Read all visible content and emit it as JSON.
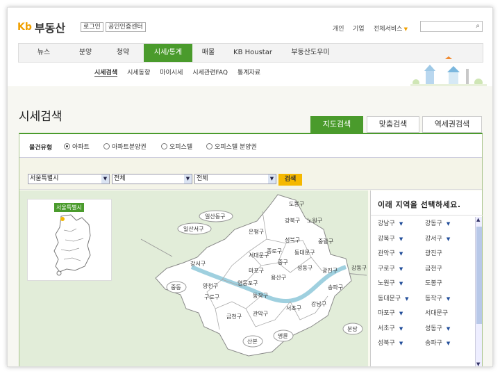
{
  "header": {
    "logo_mark": "Kb",
    "logo_text": "부동산",
    "login": "로그인",
    "agent_center": "공인인증센터",
    "links": [
      "개인",
      "기업",
      "전체서비스"
    ],
    "search_placeholder": ""
  },
  "gnb": [
    "뉴스",
    "분양",
    "청약",
    "시세/통계",
    "매물",
    "KB Houstar",
    "부동산도우미"
  ],
  "subnav": [
    "시세검색",
    "시세동향",
    "마이시세",
    "시세관련FAQ",
    "통계자료"
  ],
  "page_title": "시세검색",
  "tabs": [
    "지도검색",
    "맞춤검색",
    "역세권검색"
  ],
  "filter": {
    "label": "물건유형",
    "options": [
      "아파트",
      "아파트분양권",
      "오피스텔",
      "오피스텔 분양권"
    ],
    "selected": "아파트"
  },
  "selects": {
    "city": "서울특별시",
    "district": "전체",
    "dong": "전체",
    "search_button": "검색"
  },
  "minimap_tag": "서울특별시",
  "map_labels": [
    "도봉구",
    "노원구",
    "강북구",
    "은평구",
    "성북구",
    "중랑구",
    "일산동구",
    "일산서구",
    "종로구",
    "동대문구",
    "서대문구",
    "중구",
    "마포구",
    "성동구",
    "광진구",
    "강동구",
    "용산구",
    "강서구",
    "영등포구",
    "양천구",
    "구로구",
    "동작구",
    "송파구",
    "강남구",
    "서초구",
    "관악구",
    "금천구",
    "중동",
    "분당",
    "명륜",
    "산본"
  ],
  "list": {
    "title": "이래 지역을 선택하세요.",
    "items": [
      [
        "강남구",
        "강동구"
      ],
      [
        "강북구",
        "강서구"
      ],
      [
        "관악구",
        "광진구"
      ],
      [
        "구로구",
        "금천구"
      ],
      [
        "노원구",
        "도봉구"
      ],
      [
        "동대문구",
        "동작구"
      ],
      [
        "마포구",
        "서대문구"
      ],
      [
        "서초구",
        "성동구"
      ],
      [
        "성북구",
        "송파구"
      ]
    ]
  }
}
